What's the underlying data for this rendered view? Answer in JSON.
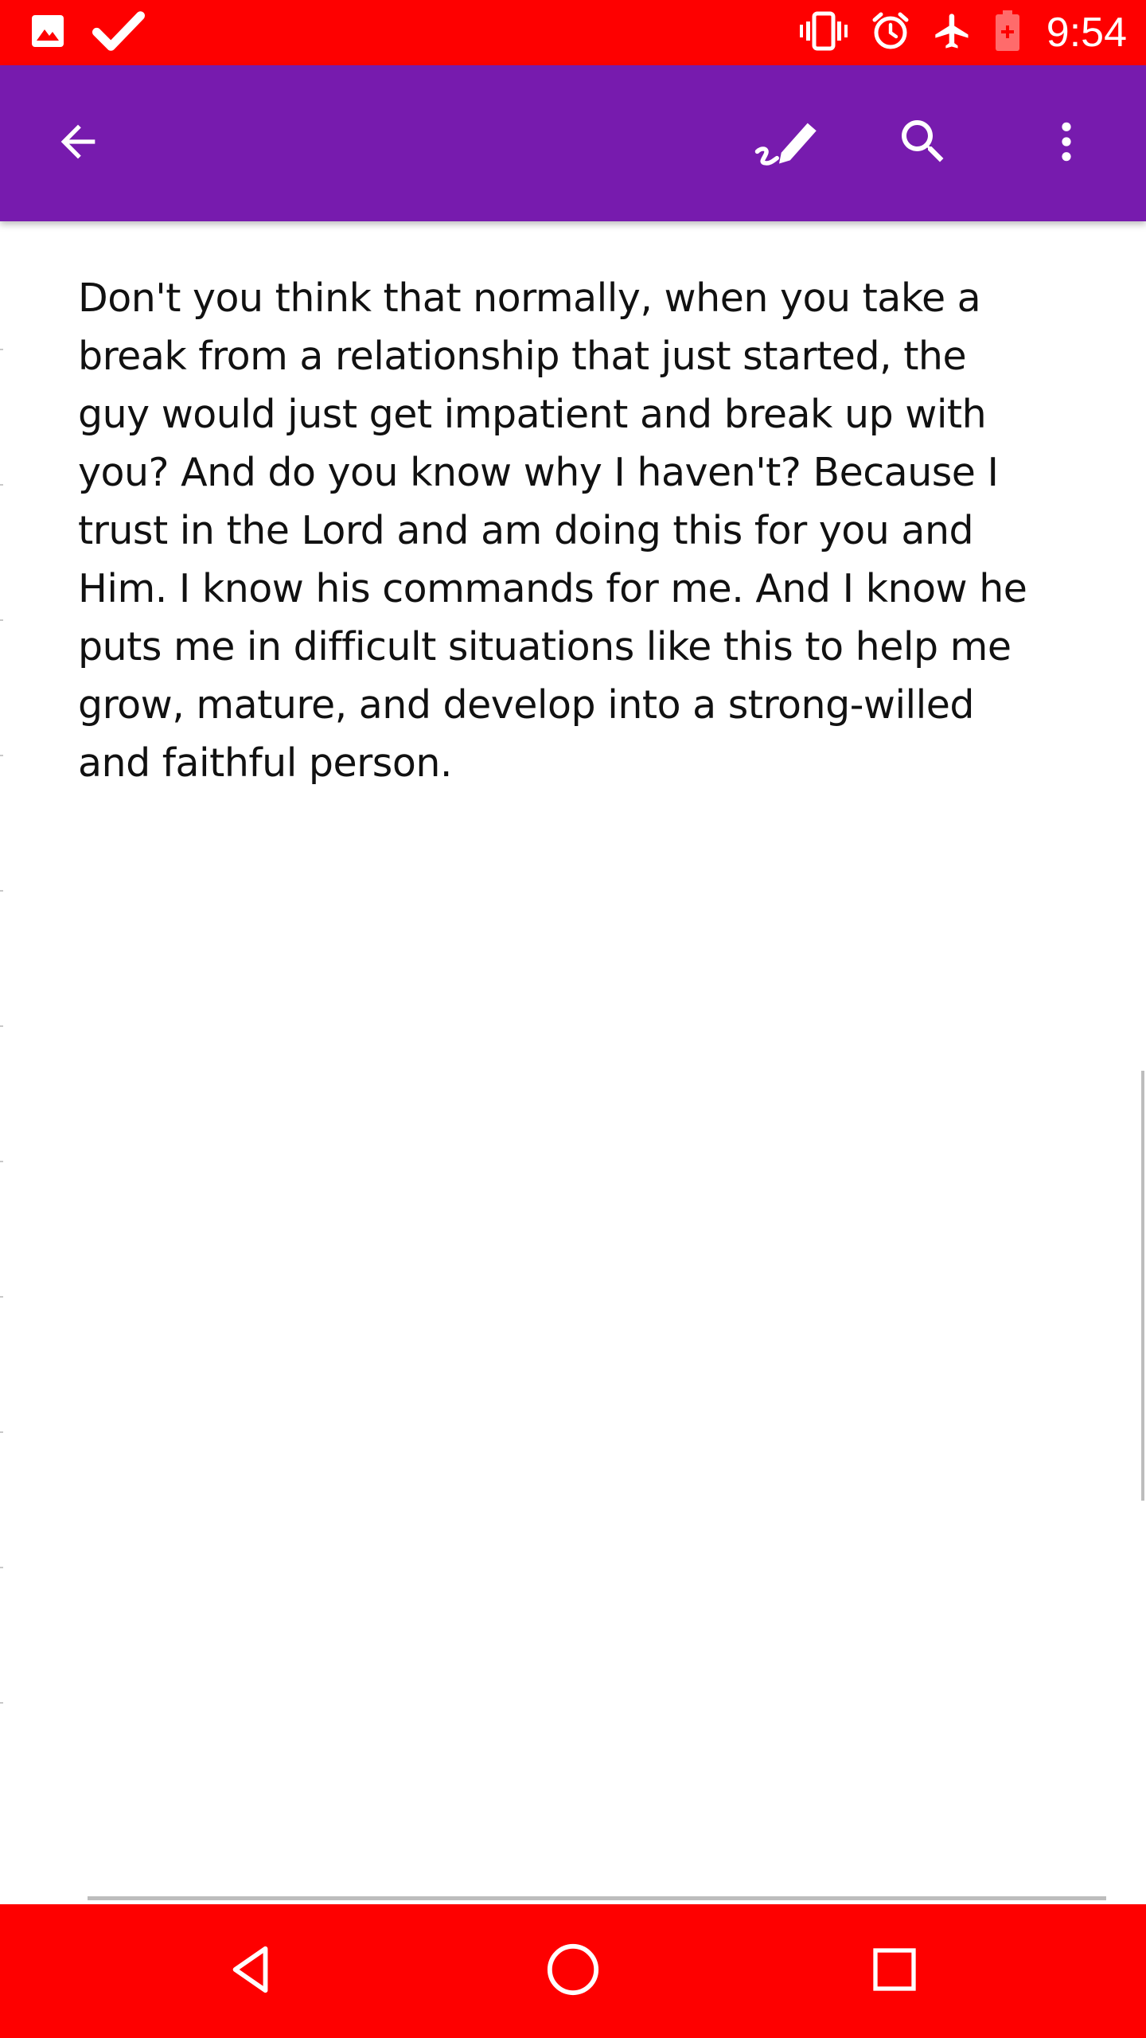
{
  "status_bar": {
    "time": "9:54",
    "background": "#fe0000",
    "left_icons": [
      "image-icon",
      "check-icon"
    ],
    "right_icons": [
      "vibrate-icon",
      "alarm-icon",
      "airplane-icon",
      "battery-icon"
    ]
  },
  "app_bar": {
    "background": "#771bae",
    "actions": [
      "back-arrow-icon",
      "edit-icon",
      "search-icon",
      "more-vert-icon"
    ]
  },
  "note": {
    "lines": [
      "Don't you think that normally, when you take a",
      "break from a relationship that just started, the",
      "guy would just get impatient and break up with",
      "you? And do you know why I haven't? Because I",
      "trust in the Lord and am doing this for you and",
      "Him. I know his commands for me. And I know he",
      "puts me in difficult situations like this to help me",
      "grow, mature, and develop into a strong-willed",
      "and faithful person."
    ]
  },
  "nav_bar": {
    "background": "#fe0000",
    "buttons": [
      "back-triangle-icon",
      "home-circle-icon",
      "recents-square-icon"
    ]
  }
}
